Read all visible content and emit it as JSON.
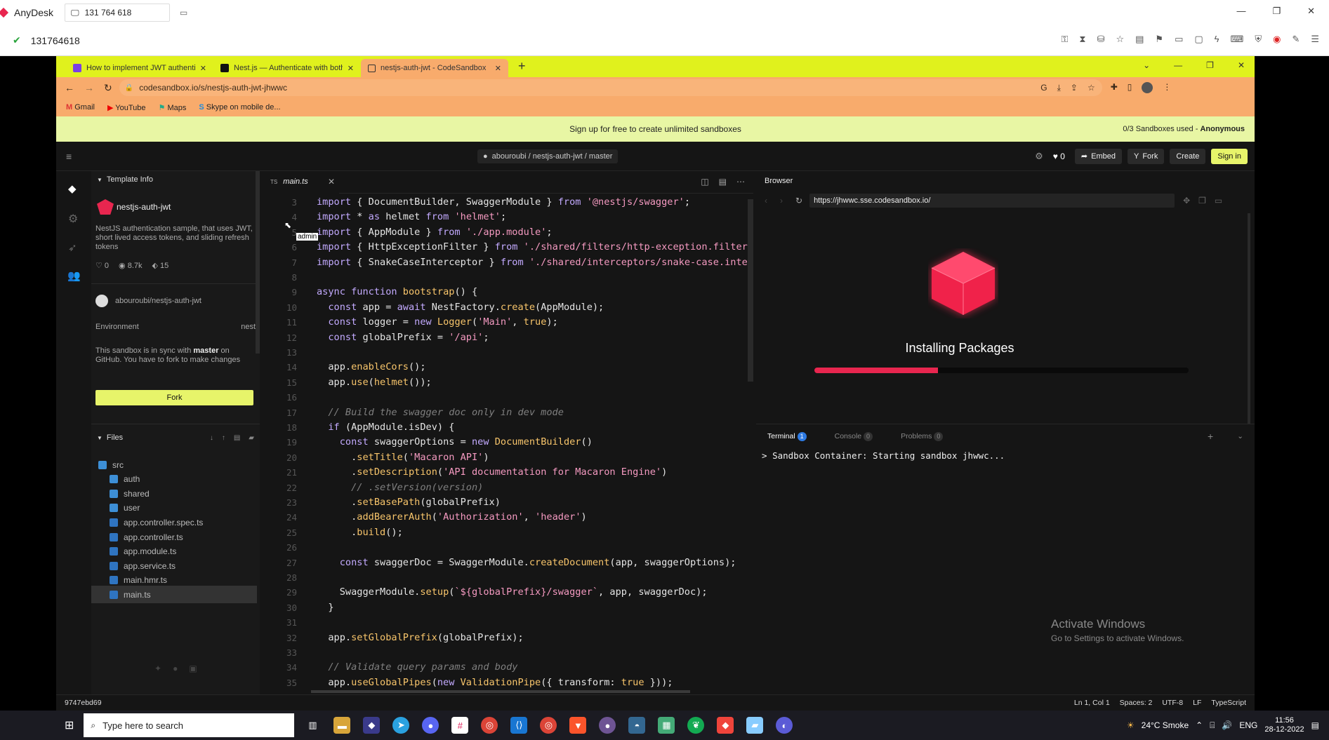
{
  "anydesk": {
    "app_name": "AnyDesk",
    "session_tab": "131 764 618",
    "address": "131764618"
  },
  "chrome": {
    "tabs": [
      {
        "title": "How to implement JWT authenti...",
        "active": false
      },
      {
        "title": "Nest.js — Authenticate with both",
        "active": false
      },
      {
        "title": "nestjs-auth-jwt - CodeSandbox",
        "active": true
      }
    ],
    "url": "codesandbox.io/s/nestjs-auth-jwt-jhwwc",
    "bookmarks": [
      "Gmail",
      "YouTube",
      "Maps",
      "Skype on mobile de..."
    ]
  },
  "banner": {
    "text": "Sign up for free to create unlimited sandboxes",
    "right_text": "0/3 Sandboxes used - ",
    "right_bold": "Anonymous"
  },
  "header": {
    "repo": "abouroubi / nestjs-auth-jwt / master",
    "likes": "0",
    "embed": "Embed",
    "fork": "Fork",
    "create": "Create",
    "signin": "Sign in"
  },
  "sidebar": {
    "template_title": "Template Info",
    "project_name": "nestjs-auth-jwt",
    "description": "NestJS authentication sample, that uses JWT, short lived access tokens, and sliding refresh tokens",
    "likes": "0",
    "views": "8.7k",
    "forks": "15",
    "github_repo": "abouroubi/nestjs-auth-jwt",
    "env_label": "Environment",
    "env_value": "nest",
    "sync_text_1": "This sandbox is in sync with ",
    "sync_bold": "master",
    "sync_text_2": " on GitHub. You have to fork to make changes",
    "fork_button": "Fork",
    "files_title": "Files",
    "files": [
      {
        "name": "src",
        "kind": "folder",
        "indent": 0
      },
      {
        "name": "auth",
        "kind": "folder",
        "indent": 1
      },
      {
        "name": "shared",
        "kind": "folder",
        "indent": 1
      },
      {
        "name": "user",
        "kind": "folder",
        "indent": 1
      },
      {
        "name": "app.controller.spec.ts",
        "kind": "file",
        "indent": 1
      },
      {
        "name": "app.controller.ts",
        "kind": "file",
        "indent": 1
      },
      {
        "name": "app.module.ts",
        "kind": "file",
        "indent": 1
      },
      {
        "name": "app.service.ts",
        "kind": "file",
        "indent": 1
      },
      {
        "name": "main.hmr.ts",
        "kind": "file",
        "indent": 1
      },
      {
        "name": "main.ts",
        "kind": "file",
        "indent": 1
      }
    ]
  },
  "editor": {
    "tab": "main.ts",
    "tab_lang": "TS",
    "tooltip": "admin",
    "lines": [
      {
        "n": "3",
        "html": "import { DocumentBuilder, SwaggerModule } from '@nestjs/swagger';"
      },
      {
        "n": "4",
        "html": "import * as helmet from 'helmet';"
      },
      {
        "n": "5",
        "html": "import { AppModule } from './app.module';"
      },
      {
        "n": "6",
        "html": "import { HttpExceptionFilter } from './shared/filters/http-exception.filter';"
      },
      {
        "n": "7",
        "html": "import { SnakeCaseInterceptor } from './shared/interceptors/snake-case.interceptor';"
      },
      {
        "n": "8",
        "html": ""
      },
      {
        "n": "9",
        "html": "async function bootstrap() {"
      },
      {
        "n": "10",
        "html": "  const app = await NestFactory.create(AppModule);"
      },
      {
        "n": "11",
        "html": "  const logger = new Logger('Main', true);"
      },
      {
        "n": "12",
        "html": "  const globalPrefix = '/api';"
      },
      {
        "n": "13",
        "html": ""
      },
      {
        "n": "14",
        "html": "  app.enableCors();"
      },
      {
        "n": "15",
        "html": "  app.use(helmet());"
      },
      {
        "n": "16",
        "html": ""
      },
      {
        "n": "17",
        "html": "  // Build the swagger doc only in dev mode"
      },
      {
        "n": "18",
        "html": "  if (AppModule.isDev) {"
      },
      {
        "n": "19",
        "html": "    const swaggerOptions = new DocumentBuilder()"
      },
      {
        "n": "20",
        "html": "      .setTitle('Macaron API')"
      },
      {
        "n": "21",
        "html": "      .setDescription('API documentation for Macaron Engine')"
      },
      {
        "n": "22",
        "html": "      // .setVersion(version)"
      },
      {
        "n": "23",
        "html": "      .setBasePath(globalPrefix)"
      },
      {
        "n": "24",
        "html": "      .addBearerAuth('Authorization', 'header')"
      },
      {
        "n": "25",
        "html": "      .build();"
      },
      {
        "n": "26",
        "html": ""
      },
      {
        "n": "27",
        "html": "    const swaggerDoc = SwaggerModule.createDocument(app, swaggerOptions);"
      },
      {
        "n": "28",
        "html": ""
      },
      {
        "n": "29",
        "html": "    SwaggerModule.setup(`${globalPrefix}/swagger`, app, swaggerDoc);"
      },
      {
        "n": "30",
        "html": "  }"
      },
      {
        "n": "31",
        "html": ""
      },
      {
        "n": "32",
        "html": "  app.setGlobalPrefix(globalPrefix);"
      },
      {
        "n": "33",
        "html": ""
      },
      {
        "n": "34",
        "html": "  // Validate query params and body"
      },
      {
        "n": "35",
        "html": "  app.useGlobalPipes(new ValidationPipe({ transform: true }));"
      }
    ]
  },
  "browser": {
    "title": "Browser",
    "url": "https://jhwwc.sse.codesandbox.io/",
    "installing": "Installing Packages",
    "progress": 0.33,
    "terminal_tab": "Terminal",
    "terminal_badge": "1",
    "console_tab": "Console",
    "console_badge": "0",
    "problems_tab": "Problems",
    "problems_badge": "0",
    "terminal_output": "Sandbox Container: Starting sandbox jhwwc...",
    "activate_title": "Activate Windows",
    "activate_sub": "Go to Settings to activate Windows."
  },
  "status": {
    "hash": "9747ebd69",
    "pos": "Ln 1, Col 1",
    "spaces": "Spaces: 2",
    "enc": "UTF-8",
    "eol": "LF",
    "lang": "TypeScript"
  },
  "taskbar": {
    "search": "Type here to search",
    "weather": "24°C  Smoke",
    "lang": "ENG",
    "time": "11:56",
    "date": "28-12-2022"
  },
  "colors": {
    "tab_yellow": "#e0f11d",
    "chrome_orange": "#f8ab6c",
    "banner": "#e8f6a4",
    "progress": "#e8264f",
    "cube": "#ff2d55",
    "fork_btn": "#e7f46a",
    "signin": "#e7f46a"
  }
}
